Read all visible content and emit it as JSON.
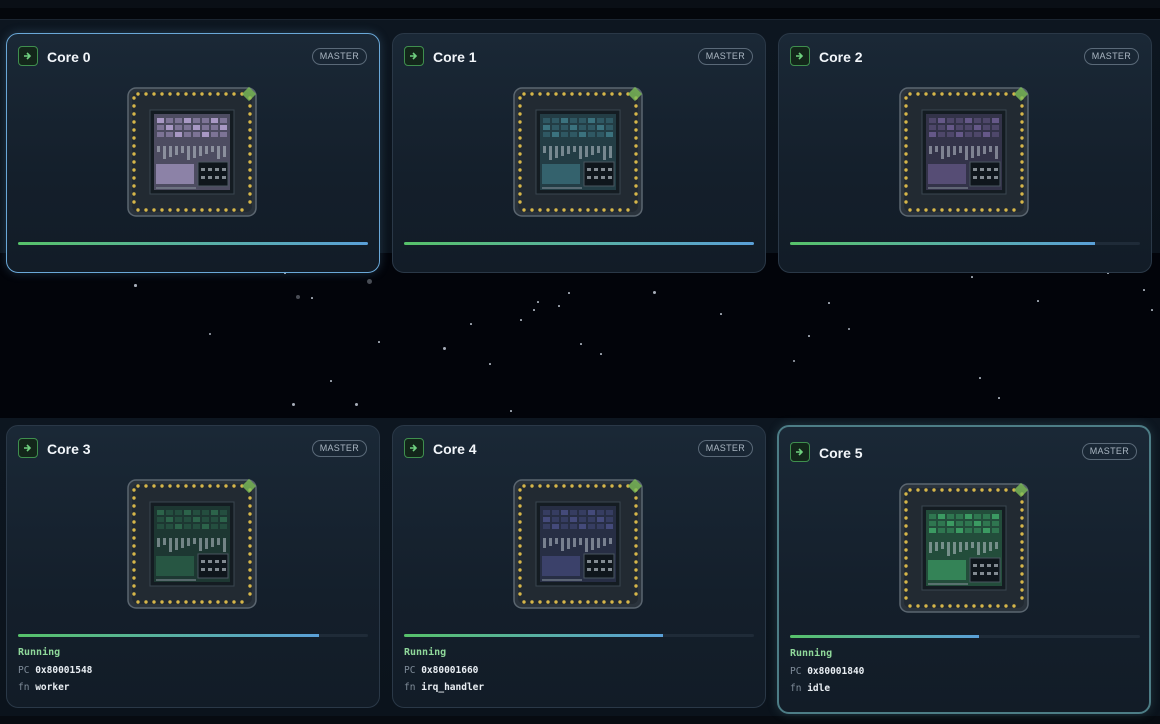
{
  "cores": [
    {
      "title": "Core 0",
      "badge": "MASTER",
      "progress": 1.0
    },
    {
      "title": "Core 1",
      "badge": "MASTER",
      "progress": 1.0
    },
    {
      "title": "Core 2",
      "badge": "MASTER",
      "progress": 0.87
    },
    {
      "title": "Core 3",
      "badge": "MASTER",
      "progress": 0.86,
      "status": "Running",
      "pc_label": "PC",
      "pc": "0x80001548",
      "fn_label": "fn",
      "fn": "worker"
    },
    {
      "title": "Core 4",
      "badge": "MASTER",
      "progress": 0.74,
      "status": "Running",
      "pc_label": "PC",
      "pc": "0x80001660",
      "fn_label": "fn",
      "fn": "irq_handler"
    },
    {
      "title": "Core 5",
      "badge": "MASTER",
      "progress": 0.54,
      "status": "Running",
      "pc_label": "PC",
      "pc": "0x80001840",
      "fn_label": "fn",
      "fn": "idle"
    }
  ],
  "colors": {
    "accent_green": "#57c26a",
    "accent_blue": "#5aa0d8",
    "status_green": "#8fd89a",
    "die_tints": [
      "#b8a6d6",
      "#3f7b88",
      "#6e5f93",
      "#2f6b4f",
      "#4a4f84",
      "#3fa86a"
    ]
  }
}
